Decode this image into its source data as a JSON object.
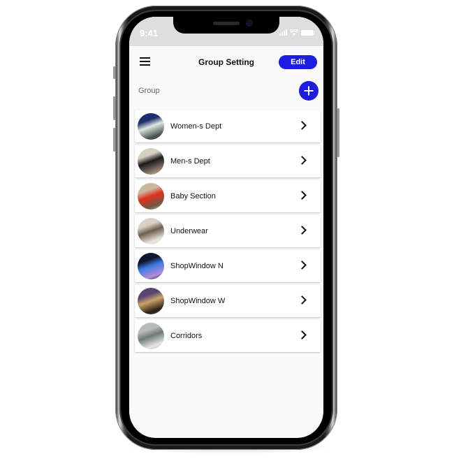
{
  "status_bar": {
    "time": "9:41",
    "icons": [
      "signal-icon",
      "wifi-icon",
      "battery-icon"
    ]
  },
  "nav": {
    "menu_icon": "hamburger-menu-icon",
    "title": "Group Setting",
    "edit_label": "Edit"
  },
  "section": {
    "label": "Group",
    "add_icon": "plus-icon"
  },
  "colors": {
    "accent": "#1d1de0",
    "background": "#f9f9f9",
    "status_bar": "#dedede"
  },
  "groups": [
    {
      "label": "Women-s Dept",
      "thumb": [
        "#1c2f6b",
        "#dfe6e3",
        "#4a5a55"
      ]
    },
    {
      "label": "Men-s Dept",
      "thumb": [
        "#d8cfc3",
        "#1a1a1a",
        "#8b7b6b"
      ]
    },
    {
      "label": "Baby Section",
      "thumb": [
        "#c9b8a0",
        "#e0301e",
        "#6d5a48"
      ]
    },
    {
      "label": "Underwear",
      "thumb": [
        "#d9d2c4",
        "#6e5e4c",
        "#ebe7e0"
      ]
    },
    {
      "label": "ShopWindow N",
      "thumb": [
        "#0f1530",
        "#3d7be0",
        "#b58ad6"
      ]
    },
    {
      "label": "ShopWindow W",
      "thumb": [
        "#5a4470",
        "#c9a46a",
        "#2a1e18"
      ]
    },
    {
      "label": "Corridors",
      "thumb": [
        "#b8bcbc",
        "#6e7a74",
        "#e6e6e2"
      ]
    }
  ]
}
